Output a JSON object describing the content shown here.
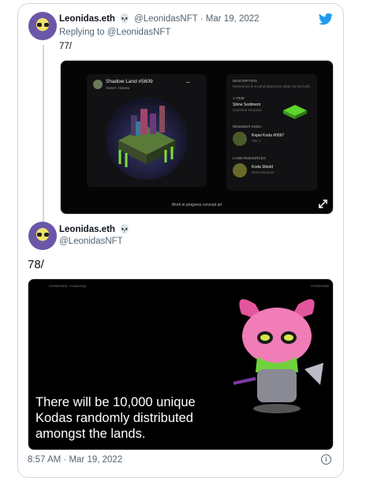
{
  "tweet1": {
    "display_name": "Leonidas.eth",
    "skull": "💀",
    "handle": "@LeonidasNFT",
    "separator": "·",
    "date": "Mar 19, 2022",
    "replying_prefix": "Replying to",
    "replying_handle": "@LeonidasNFT",
    "text": "77/",
    "media": {
      "left_panel_title": "Shadow Land #5609",
      "left_panel_sub": "Owner: Haruko",
      "right_panel_heading": "DESCRIPTION",
      "right_panel_text": "Resources in a Land determine what can be built.",
      "right_section_1": "1 ITEM",
      "right_item_1": "Slime Sediment",
      "right_item_1_sub": "Common resource",
      "right_section_2": "RESIDENT KODA",
      "right_item_2": "Kepei Koda #0097",
      "right_item_2_sub": "Tier 1",
      "right_section_3": "LAND RESOURCES",
      "right_item_3": "Koda Shield",
      "right_item_3_sub": "Rare resource",
      "caption": "Work in progress concept art"
    }
  },
  "tweet2": {
    "display_name": "Leonidas.eth",
    "skull": "💀",
    "handle": "@LeonidasNFT",
    "text": "78/",
    "media": {
      "header_left": "OTHERSIDE  •  KODA FAQ",
      "header_right": "OTHERSIDE",
      "caption_line1": "There will be 10,000 unique",
      "caption_line2": "Kodas randomly distributed",
      "caption_line3": "amongst the lands."
    },
    "time": "8:57 AM",
    "separator": "·",
    "date": "Mar 19, 2022"
  },
  "colors": {
    "twitter_blue": "#1d9bf0",
    "muted_text": "#536471",
    "border": "#cfd9de"
  },
  "icons": [
    "twitter-bird-icon",
    "expand-icon",
    "info-icon"
  ]
}
